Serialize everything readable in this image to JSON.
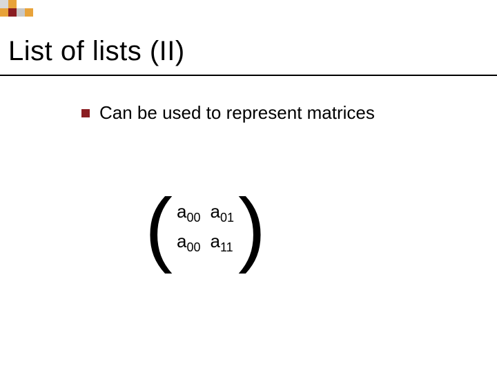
{
  "logo": {
    "squares": [
      "#d9d9d9",
      "#e8a33a",
      "transparent",
      "transparent",
      "#e8a33a",
      "#8a1d22",
      "#c8c8c8",
      "#e8a33a"
    ]
  },
  "title": "List of lists (II)",
  "bullet_text": "Can be used to represent matrices",
  "matrix": {
    "open": "(",
    "close": ")",
    "cells": [
      {
        "base": "a",
        "sub": "00"
      },
      {
        "base": "a",
        "sub": "01"
      },
      {
        "base": "a",
        "sub": "00"
      },
      {
        "base": "a",
        "sub": "11"
      }
    ]
  }
}
